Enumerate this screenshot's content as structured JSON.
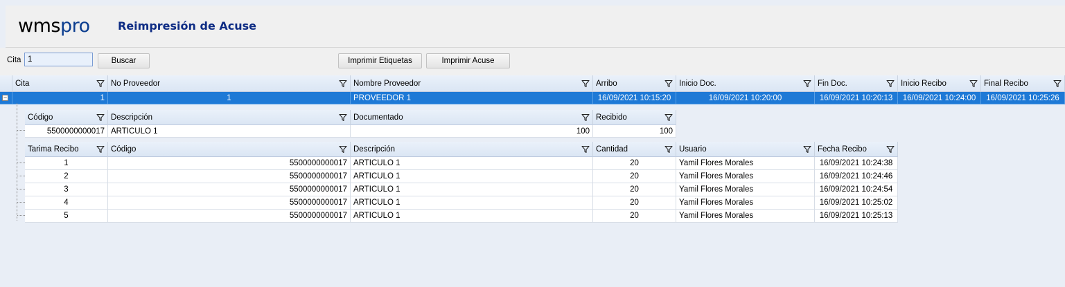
{
  "header": {
    "logo_wms": "wms",
    "logo_pro": "pro",
    "title": "Reimpresión de Acuse"
  },
  "toolbar": {
    "cita_label": "Cita",
    "cita_value": "1",
    "buscar_label": "Buscar",
    "imprimir_etiquetas_label": "Imprimir Etiquetas",
    "imprimir_acuse_label": "Imprimir Acuse"
  },
  "main_grid": {
    "columns": [
      "Cita",
      "No Proveedor",
      "Nombre Proveedor",
      "Arribo",
      "Inicio Doc.",
      "Fin Doc.",
      "Inicio Recibo",
      "Final Recibo"
    ],
    "rows": [
      [
        "1",
        "1",
        "PROVEEDOR 1",
        "16/09/2021 10:15:20",
        "16/09/2021 10:20:00",
        "16/09/2021 10:20:13",
        "16/09/2021 10:24:00",
        "16/09/2021 10:25:26"
      ]
    ],
    "expander_glyph": "−"
  },
  "detail_grid": {
    "columns": [
      "Código",
      "Descripción",
      "Documentado",
      "Recibido"
    ],
    "rows": [
      [
        "5500000000017",
        "ARTICULO 1",
        "100",
        "100"
      ]
    ]
  },
  "pallet_grid": {
    "columns": [
      "Tarima Recibo",
      "Código",
      "Descripción",
      "Cantidad",
      "Usuario",
      "Fecha Recibo"
    ],
    "rows": [
      [
        "1",
        "5500000000017",
        "ARTICULO 1",
        "20",
        "Yamil Flores Morales",
        "16/09/2021 10:24:38"
      ],
      [
        "2",
        "5500000000017",
        "ARTICULO 1",
        "20",
        "Yamil Flores Morales",
        "16/09/2021 10:24:46"
      ],
      [
        "3",
        "5500000000017",
        "ARTICULO 1",
        "20",
        "Yamil Flores Morales",
        "16/09/2021 10:24:54"
      ],
      [
        "4",
        "5500000000017",
        "ARTICULO 1",
        "20",
        "Yamil Flores Morales",
        "16/09/2021 10:25:02"
      ],
      [
        "5",
        "5500000000017",
        "ARTICULO 1",
        "20",
        "Yamil Flores Morales",
        "16/09/2021 10:25:13"
      ]
    ]
  },
  "icons": {
    "filter": "filter-icon",
    "expander": "collapse-icon"
  },
  "colors": {
    "selection": "#1e79d6",
    "title": "#0e2c84",
    "background": "#e9eef6"
  }
}
